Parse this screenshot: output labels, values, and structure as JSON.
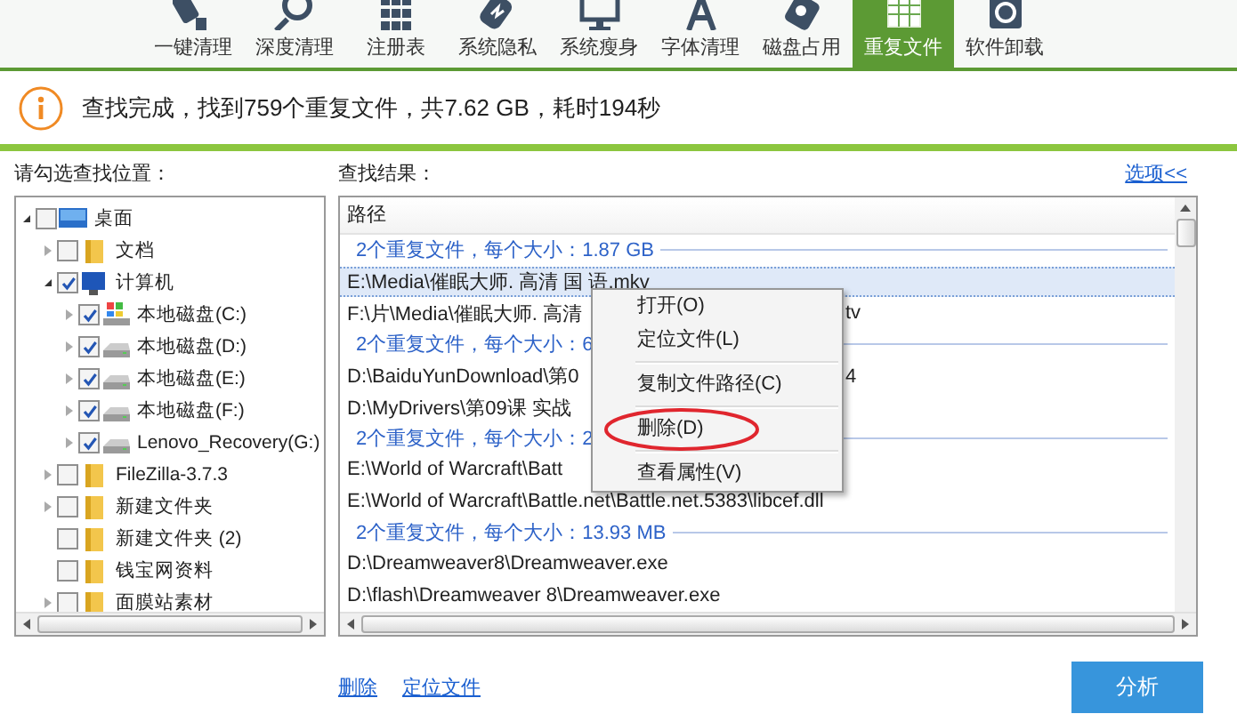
{
  "toolbar": {
    "tabs": [
      {
        "label": "一键清理",
        "selected": false
      },
      {
        "label": "深度清理",
        "selected": false
      },
      {
        "label": "注册表",
        "selected": false
      },
      {
        "label": "系统隐私",
        "selected": false
      },
      {
        "label": "系统瘦身",
        "selected": false
      },
      {
        "label": "字体清理",
        "selected": false
      },
      {
        "label": "磁盘占用",
        "selected": false
      },
      {
        "label": "重复文件",
        "selected": true
      },
      {
        "label": "软件卸载",
        "selected": false
      }
    ]
  },
  "status": {
    "message": "查找完成，找到759个重复文件，共7.62 GB，耗时194秒"
  },
  "locations": {
    "label": "请勾选查找位置：",
    "tree": [
      {
        "label": "桌面",
        "kind": "desktop",
        "checked": false,
        "expanded": true,
        "children": [
          {
            "label": "文档",
            "kind": "folder",
            "checked": false,
            "expanded": false
          },
          {
            "label": "计算机",
            "kind": "computer",
            "checked": true,
            "expanded": true,
            "children": [
              {
                "label": "本地磁盘(C:)",
                "kind": "system-drive",
                "checked": true,
                "expanded": false
              },
              {
                "label": "本地磁盘(D:)",
                "kind": "drive",
                "checked": true,
                "expanded": false
              },
              {
                "label": "本地磁盘(E:)",
                "kind": "drive",
                "checked": true,
                "expanded": false
              },
              {
                "label": "本地磁盘(F:)",
                "kind": "drive",
                "checked": true,
                "expanded": false
              },
              {
                "label": "Lenovo_Recovery(G:)",
                "kind": "drive",
                "checked": true,
                "expanded": false
              }
            ]
          },
          {
            "label": "FileZilla-3.7.3",
            "kind": "folder",
            "checked": false,
            "expanded": false
          },
          {
            "label": "新建文件夹",
            "kind": "folder",
            "checked": false,
            "expanded": false
          },
          {
            "label": "新建文件夹 (2)",
            "kind": "folder",
            "checked": false
          },
          {
            "label": "钱宝网资料",
            "kind": "folder",
            "checked": false
          },
          {
            "label": "面膜站素材",
            "kind": "folder",
            "checked": false,
            "expanded": false
          }
        ]
      }
    ]
  },
  "results": {
    "label": "查找结果：",
    "options_link": "选项<<",
    "column": "路径",
    "rows": [
      {
        "kind": "group",
        "text": "2个重复文件，每个大小：1.87 GB"
      },
      {
        "kind": "file",
        "text": "E:\\Media\\催眠大师. 高清  国 语.mkv",
        "selected": true
      },
      {
        "kind": "file",
        "text": "F:\\片\\Media\\催眠大师. 高清",
        "tail": "tv",
        "selected": false
      },
      {
        "kind": "group",
        "text": "2个重复文件，每个大小：6"
      },
      {
        "kind": "file",
        "text": "D:\\BaiduYunDownload\\第0",
        "tail": "4",
        "selected": false
      },
      {
        "kind": "file",
        "text": "D:\\MyDrivers\\第09课 实战",
        "selected": false
      },
      {
        "kind": "group",
        "text": "2个重复文件，每个大小：2"
      },
      {
        "kind": "file",
        "text": "E:\\World of Warcraft\\Batt",
        "selected": false
      },
      {
        "kind": "file",
        "text": "E:\\World of Warcraft\\Battle.net\\Battle.net.5383\\libcef.dll",
        "selected": false
      },
      {
        "kind": "group",
        "text": "2个重复文件，每个大小：13.93 MB"
      },
      {
        "kind": "file",
        "text": "D:\\Dreamweaver8\\Dreamweaver.exe",
        "selected": false
      },
      {
        "kind": "file",
        "text": "D:\\flash\\Dreamweaver 8\\Dreamweaver.exe",
        "selected": false
      }
    ]
  },
  "context_menu": {
    "items": [
      {
        "kind": "item",
        "label": "打开(O)",
        "circled": false
      },
      {
        "kind": "item",
        "label": "定位文件(L)",
        "circled": false
      },
      {
        "kind": "separator"
      },
      {
        "kind": "item",
        "label": "复制文件路径(C)",
        "circled": false
      },
      {
        "kind": "separator"
      },
      {
        "kind": "item",
        "label": "删除(D)",
        "circled": true
      },
      {
        "kind": "separator"
      },
      {
        "kind": "item",
        "label": "查看属性(V)",
        "circled": false
      }
    ]
  },
  "footer": {
    "links": [
      "删除",
      "定位文件"
    ],
    "button": "分析"
  }
}
